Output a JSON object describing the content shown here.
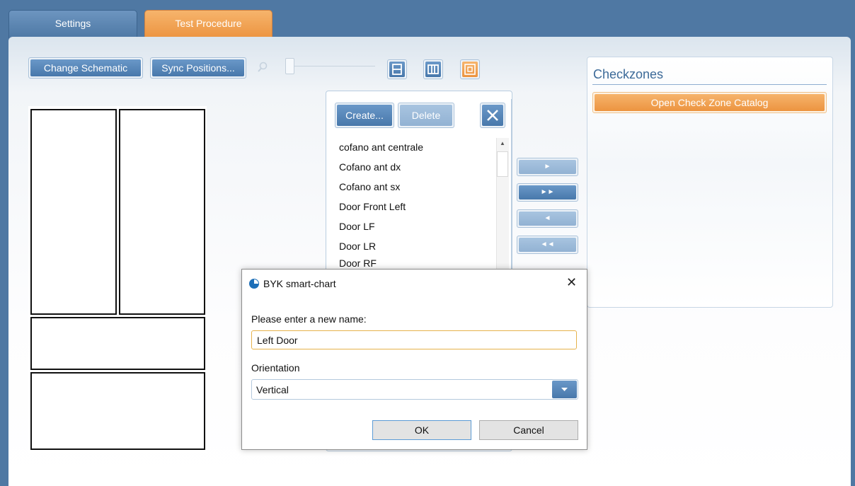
{
  "tabs": [
    {
      "label": "Settings",
      "active": false
    },
    {
      "label": "Test Procedure",
      "active": true
    }
  ],
  "toolbar": {
    "change_schematic": "Change Schematic",
    "sync_positions": "Sync Positions...",
    "zoom_icon": "magnifier-icon",
    "layout_icons": [
      "horizontal-layout-icon",
      "vertical-layout-icon",
      "fit-layout-icon"
    ]
  },
  "zone_list": {
    "create_label": "Create...",
    "delete_label": "Delete",
    "items": [
      "cofano ant centrale",
      "Cofano ant dx",
      "Cofano ant sx",
      "Door Front Left",
      "Door LF",
      "Door LR",
      "Door RF"
    ],
    "move_buttons": [
      "►",
      "►►",
      "◄",
      "◄◄"
    ]
  },
  "checkzones": {
    "title": "Checkzones",
    "open_catalog": "Open Check Zone Catalog"
  },
  "dialog": {
    "title": "BYK smart-chart",
    "close": "✕",
    "name_prompt": "Please enter a new name:",
    "name_value": "Left Door",
    "orientation_label": "Orientation",
    "orientation_value": "Vertical",
    "ok": "OK",
    "cancel": "Cancel"
  },
  "colors": {
    "background_blue": "#4f78a3",
    "accent_orange": "#ec9440",
    "button_blue": "#4878ab"
  }
}
